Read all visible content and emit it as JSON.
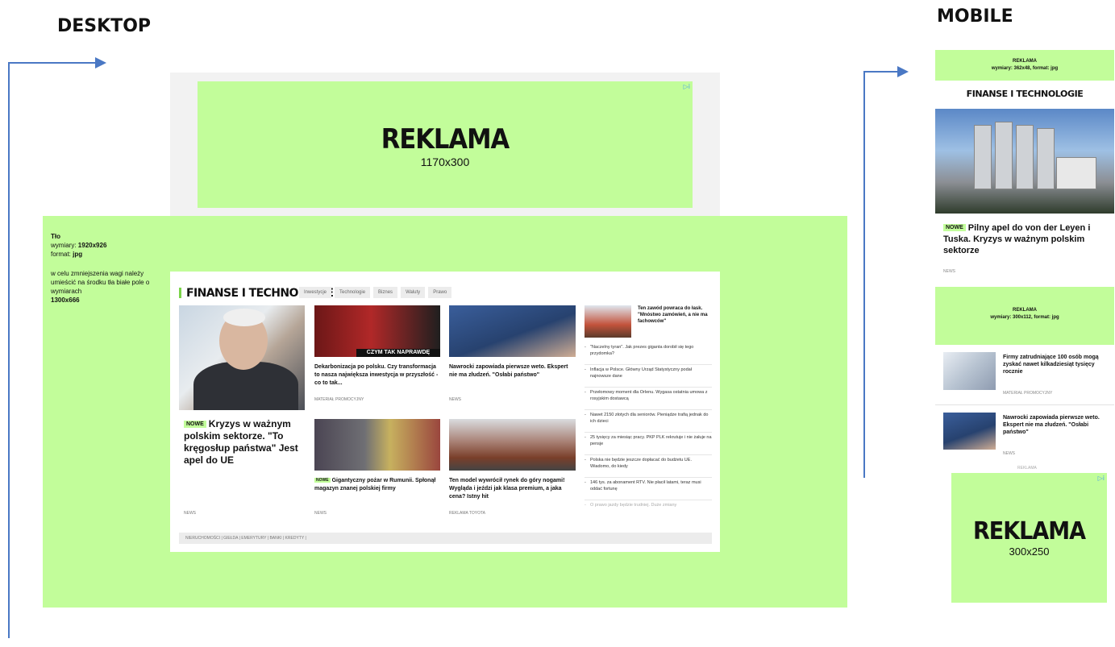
{
  "labels": {
    "desktop": "DESKTOP",
    "mobile": "MOBILE"
  },
  "top_ad": {
    "title": "REKLAMA",
    "size": "1170x300"
  },
  "background": {
    "name": "Tło",
    "dims_label": "wymiary:",
    "dims": "1920x926",
    "format_label": "format:",
    "format": "jpg",
    "note": "w celu zmniejszenia wagi należy umieścić na środku tła białe pole o wymiarach",
    "note_dims": "1300x666"
  },
  "desktop": {
    "section_title": "FINANSE I TECHNOLOGIE",
    "tabs": [
      "Inwestycje",
      "Technologie",
      "Biznes",
      "Waluty",
      "Prawo"
    ],
    "main": {
      "badge": "NOWE",
      "title": "Kryzys w ważnym polskim sektorze. \"To kręgosłup państwa\" Jest apel do UE",
      "meta": "NEWS"
    },
    "cards": [
      {
        "strip": "CZYM TAK NAPRAWDĘ",
        "title": "Dekarbonizacja po polsku. Czy transformacja to nasza największa inwestycja w przyszłość - co to tak...",
        "meta": "MATERIAŁ PROMOCYJNY"
      },
      {
        "title": "Nawrocki zapowiada pierwsze weto. Ekspert nie ma złudzeń. \"Osłabi państwo\"",
        "meta": "NEWS"
      },
      {
        "badge": "NOWE",
        "title": "Gigantyczny pożar w Rumunii. Spłonął magazyn znanej polskiej firmy",
        "meta": "NEWS"
      },
      {
        "title": "Ten model wywrócił rynek do góry nogami! Wygląda i jeździ jak klasa premium, a jaka cena? Istny hit",
        "meta": "REKLAMA TOYOTA"
      }
    ],
    "side_lead": "Ten zawód powraca do łask. \"Mnóstwo zamówień, a nie ma fachowców\"",
    "side_items": [
      "\"Naczelny tyran\". Jak prezes giganta dorobił się tego przydomka?",
      "Inflacja w Polsce. Główny Urząd Statystyczny podał najnowsze dane",
      "Przełomowy moment dla Orlenu. Wygasa ostatnia umowa z rosyjskim dostawcą",
      "Nawet 2150 złotych dla seniorów. Pieniądze trafią jednak do ich dzieci",
      "25 tysięcy za miesiąc pracy. PKP PLK rekrutuje i nie żałuje na pensje",
      "Polska nie będzie jeszcze dopłacać do budżetu UE. Wiadomo, do kiedy",
      "146 tys. za abonament RTV. Nie płacił latami, teraz musi oddać fortunę",
      "O prawo jazdy będzie trudniej. Duże zmiany"
    ],
    "footer": "NIERUCHOMOŚCI | GIEŁDA | EMERYTURY | BANKI | KREDYTY |"
  },
  "mobile": {
    "ad_top": {
      "title": "REKLAMA",
      "dims": "wymiary: 362x48, format: jpg"
    },
    "section_title": "FINANSE I TECHNOLOGIE",
    "hero": {
      "badge": "NOWE",
      "title": "Pilny apel do von der Leyen i Tuska. Kryzys w ważnym polskim sektorze",
      "meta": "NEWS"
    },
    "ad_mid": {
      "title": "REKLAMA",
      "dims": "wymiary: 300x112, format: jpg"
    },
    "rows": [
      {
        "title": "Firmy zatrudniające 100 osób mogą zyskać nawet kilkadziesiąt tysięcy rocznie",
        "meta": "MATERIAŁ PROMOCYJNY"
      },
      {
        "title": "Nawrocki zapowiada pierwsze weto. Ekspert nie ma złudzeń. \"Osłabi państwo\"",
        "meta": "NEWS"
      }
    ],
    "ad_label": "REKLAMA",
    "ad_bottom": {
      "title": "REKLAMA",
      "size": "300x250"
    }
  },
  "colors": {
    "ad_green": "#c2fd9a",
    "arrow": "#4a78c4"
  }
}
